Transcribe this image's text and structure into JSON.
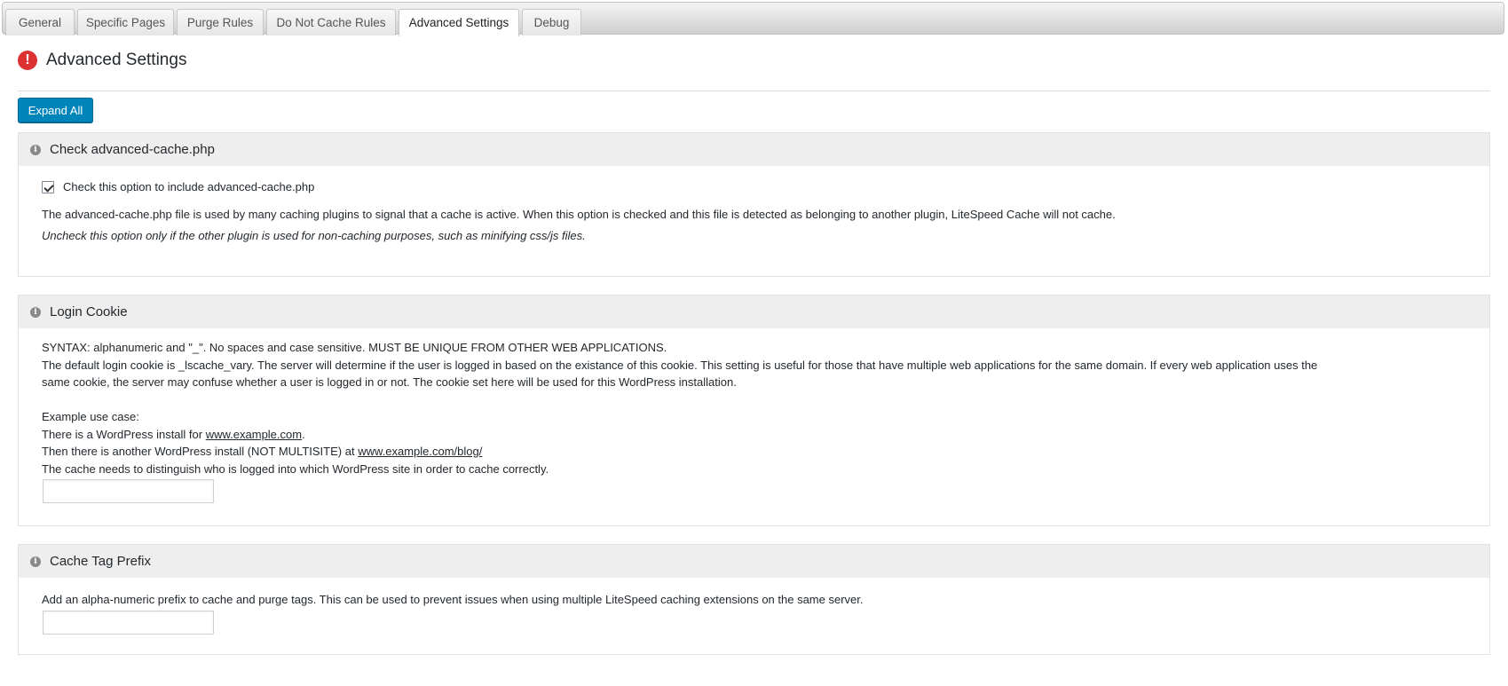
{
  "tabs": [
    {
      "label": "General",
      "active": false
    },
    {
      "label": "Specific Pages",
      "active": false
    },
    {
      "label": "Purge Rules",
      "active": false
    },
    {
      "label": "Do Not Cache Rules",
      "active": false
    },
    {
      "label": "Advanced Settings",
      "active": true
    },
    {
      "label": "Debug",
      "active": false
    }
  ],
  "header": {
    "icon": "exclamation-icon",
    "title": "Advanced Settings"
  },
  "toolbar": {
    "expand_label": "Expand All"
  },
  "colors": {
    "primary_button": "#0085ba",
    "alert_icon": "#dc3232",
    "section_header": "#eeeeee"
  },
  "sections": {
    "advanced_cache": {
      "title": "Check advanced-cache.php",
      "checkbox_checked": true,
      "checkbox_label": "Check this option to include advanced-cache.php",
      "description": "The advanced-cache.php file is used by many caching plugins to signal that a cache is active. When this option is checked and this file is detected as belonging to another plugin, LiteSpeed Cache will not cache.",
      "note": "Uncheck this option only if the other plugin is used for non-caching purposes, such as minifying css/js files."
    },
    "login_cookie": {
      "title": "Login Cookie",
      "syntax": "SYNTAX: alphanumeric and \"_\". No spaces and case sensitive. MUST BE UNIQUE FROM OTHER WEB APPLICATIONS.",
      "desc_line1": "The default login cookie is _lscache_vary. The server will determine if the user is logged in based on the existance of this cookie. This setting is useful for those that have multiple web applications for the same domain. If every web application uses the",
      "desc_line2": "same cookie, the server may confuse whether a user is logged in or not. The cookie set here will be used for this WordPress installation.",
      "example_heading": "Example use case:",
      "example1_prefix": "There is a WordPress install for ",
      "example1_link": "www.example.com",
      "example1_suffix": ".",
      "example2_prefix": "Then there is another WordPress install (NOT MULTISITE) at ",
      "example2_link": "www.example.com/blog/",
      "example3": "The cache needs to distinguish who is logged into which WordPress site in order to cache correctly.",
      "input_value": ""
    },
    "cache_tag_prefix": {
      "title": "Cache Tag Prefix",
      "description": "Add an alpha-numeric prefix to cache and purge tags. This can be used to prevent issues when using multiple LiteSpeed caching extensions on the same server.",
      "input_value": ""
    }
  }
}
